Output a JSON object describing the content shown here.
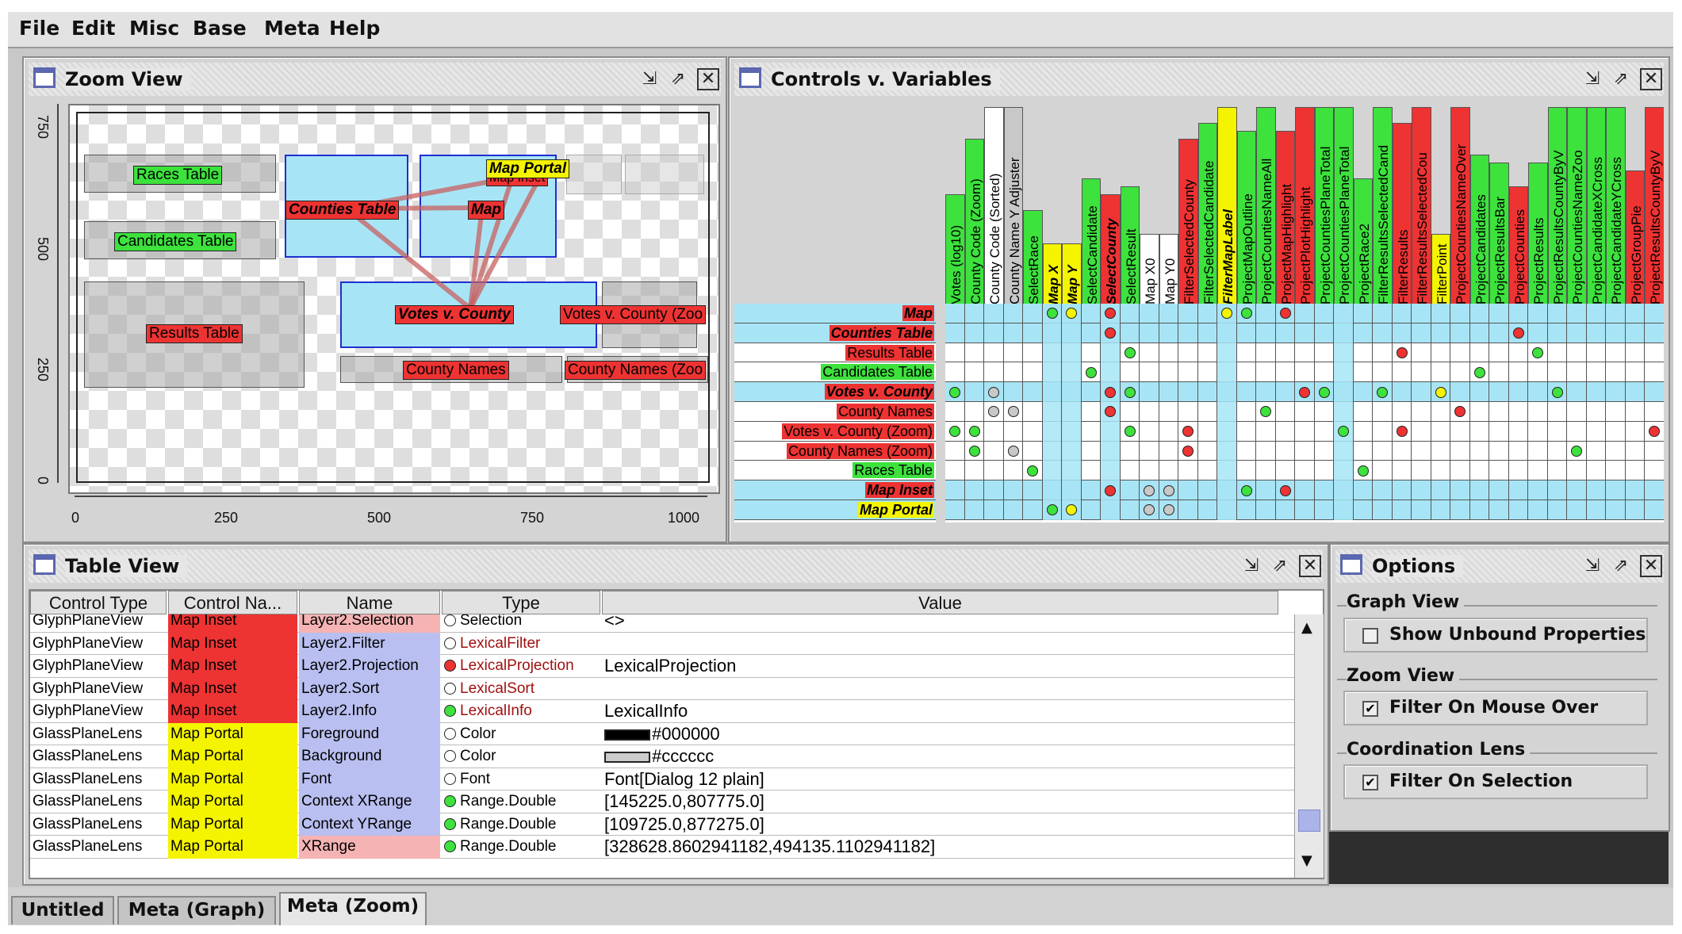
{
  "menu": [
    "File",
    "Edit",
    "Misc",
    "Base",
    "Meta",
    "Help"
  ],
  "zoom_view": {
    "title": "Zoom View",
    "y_ticks": [
      "750",
      "500",
      "250",
      "0"
    ],
    "x_ticks": [
      "0",
      "250",
      "500",
      "750",
      "1000"
    ],
    "labels": {
      "races": "Races Table",
      "candidates": "Candidates Table",
      "results": "Results Table",
      "counties": "Counties Table",
      "map": "Map",
      "map_portal": "Map Portal",
      "map_inset": "Map Inset",
      "votes": "Votes v. County",
      "votes_zoom": "Votes v. County (Zoo",
      "county_names": "County Names",
      "county_names_zoom": "County Names (Zoo"
    }
  },
  "controls_view": {
    "title": "Controls v. Variables",
    "columns": [
      {
        "name": "Votes (log10)",
        "color": "#3de23d",
        "style": "n"
      },
      {
        "name": "County Code (Zoom)",
        "color": "#3de23d",
        "style": "n"
      },
      {
        "name": "County Code (Sorted)",
        "color": "#ffffff",
        "style": "n"
      },
      {
        "name": "County Name Y Adjuster",
        "color": "#c8c8c8",
        "style": "n"
      },
      {
        "name": "SelectRace",
        "color": "#3de23d",
        "style": "n"
      },
      {
        "name": "Map X",
        "color": "#f4f400",
        "style": "bi"
      },
      {
        "name": "Map Y",
        "color": "#f4f400",
        "style": "bi"
      },
      {
        "name": "SelectCandidate",
        "color": "#3de23d",
        "style": "n"
      },
      {
        "name": "SelectCounty",
        "color": "#ee3333",
        "style": "bi"
      },
      {
        "name": "SelectResult",
        "color": "#3de23d",
        "style": "n"
      },
      {
        "name": "Map X0",
        "color": "#ffffff",
        "style": "n"
      },
      {
        "name": "Map Y0",
        "color": "#ffffff",
        "style": "n"
      },
      {
        "name": "FilterSelectedCounty",
        "color": "#ee3333",
        "style": "n"
      },
      {
        "name": "FilterSelectedCandidate",
        "color": "#3de23d",
        "style": "n"
      },
      {
        "name": "FilterMapLabel",
        "color": "#f4f400",
        "style": "bi"
      },
      {
        "name": "ProjectMapOutline",
        "color": "#3de23d",
        "style": "n"
      },
      {
        "name": "ProjectCountiesNameAll",
        "color": "#3de23d",
        "style": "n"
      },
      {
        "name": "ProjectMapHighlight",
        "color": "#ee3333",
        "style": "n"
      },
      {
        "name": "ProjectPlotHighlight",
        "color": "#ee3333",
        "style": "n"
      },
      {
        "name": "ProjectCountiesPlaneTotal",
        "color": "#3de23d",
        "style": "n"
      },
      {
        "name": "ProjectCountiesPlaneTotal",
        "color": "#3de23d",
        "style": "n"
      },
      {
        "name": "ProjectRace2",
        "color": "#3de23d",
        "style": "n"
      },
      {
        "name": "FilterResultsSelectedCand",
        "color": "#3de23d",
        "style": "n"
      },
      {
        "name": "FilterResults",
        "color": "#ee3333",
        "style": "n"
      },
      {
        "name": "FilterResultsSelectedCou",
        "color": "#ee3333",
        "style": "n"
      },
      {
        "name": "FilterPoint",
        "color": "#f4f400",
        "style": "n"
      },
      {
        "name": "ProjectCountiesNameOver",
        "color": "#ee3333",
        "style": "n"
      },
      {
        "name": "ProjectCandidates",
        "color": "#3de23d",
        "style": "n"
      },
      {
        "name": "ProjectResultsBar",
        "color": "#3de23d",
        "style": "n"
      },
      {
        "name": "ProjectCounties",
        "color": "#ee3333",
        "style": "n"
      },
      {
        "name": "ProjectResults",
        "color": "#3de23d",
        "style": "n"
      },
      {
        "name": "ProjectResultsCountyByV",
        "color": "#3de23d",
        "style": "n"
      },
      {
        "name": "ProjectCountiesNameZoo",
        "color": "#3de23d",
        "style": "n"
      },
      {
        "name": "ProjectCandidateXCross",
        "color": "#3de23d",
        "style": "n"
      },
      {
        "name": "ProjectCandidateYCross",
        "color": "#3de23d",
        "style": "n"
      },
      {
        "name": "ProjectGroupPie",
        "color": "#ee3333",
        "style": "n"
      },
      {
        "name": "ProjectResultsCountyByV",
        "color": "#ee3333",
        "style": "n"
      }
    ],
    "rows": [
      {
        "name": "Map",
        "color": "#ee3333",
        "style": "bi",
        "cyan": true
      },
      {
        "name": "Counties Table",
        "color": "#ee3333",
        "style": "bi",
        "cyan": true
      },
      {
        "name": "Results Table",
        "color": "#ee3333",
        "style": "n",
        "cyan": false
      },
      {
        "name": "Candidates Table",
        "color": "#3de23d",
        "style": "n",
        "cyan": false
      },
      {
        "name": "Votes v. County",
        "color": "#ee3333",
        "style": "bi",
        "cyan": true
      },
      {
        "name": "County Names",
        "color": "#ee3333",
        "style": "n",
        "cyan": false
      },
      {
        "name": "Votes v. County (Zoom)",
        "color": "#ee3333",
        "style": "n",
        "cyan": false
      },
      {
        "name": "County Names (Zoom)",
        "color": "#ee3333",
        "style": "n",
        "cyan": false
      },
      {
        "name": "Races Table",
        "color": "#3de23d",
        "style": "n",
        "cyan": false
      },
      {
        "name": "Map Inset",
        "color": "#ee3333",
        "style": "bi",
        "cyan": true
      },
      {
        "name": "Map Portal",
        "color": "#f4f400",
        "style": "bi",
        "cyan": true
      }
    ],
    "dots": [
      [
        0,
        5,
        "#3de23d"
      ],
      [
        0,
        6,
        "#f4f400"
      ],
      [
        0,
        8,
        "#ee3333"
      ],
      [
        0,
        14,
        "#f4f400"
      ],
      [
        0,
        15,
        "#3de23d"
      ],
      [
        0,
        17,
        "#ee3333"
      ],
      [
        1,
        8,
        "#ee3333"
      ],
      [
        1,
        29,
        "#ee3333"
      ],
      [
        2,
        9,
        "#3de23d"
      ],
      [
        2,
        23,
        "#ee3333"
      ],
      [
        2,
        30,
        "#3de23d"
      ],
      [
        3,
        7,
        "#3de23d"
      ],
      [
        3,
        27,
        "#3de23d"
      ],
      [
        4,
        0,
        "#3de23d"
      ],
      [
        4,
        2,
        "#c8c8c8"
      ],
      [
        4,
        8,
        "#ee3333"
      ],
      [
        4,
        9,
        "#3de23d"
      ],
      [
        4,
        18,
        "#ee3333"
      ],
      [
        4,
        19,
        "#3de23d"
      ],
      [
        4,
        22,
        "#3de23d"
      ],
      [
        4,
        25,
        "#f4f400"
      ],
      [
        4,
        31,
        "#3de23d"
      ],
      [
        5,
        2,
        "#c8c8c8"
      ],
      [
        5,
        3,
        "#c8c8c8"
      ],
      [
        5,
        8,
        "#ee3333"
      ],
      [
        5,
        16,
        "#3de23d"
      ],
      [
        5,
        26,
        "#ee3333"
      ],
      [
        6,
        0,
        "#3de23d"
      ],
      [
        6,
        1,
        "#3de23d"
      ],
      [
        6,
        9,
        "#3de23d"
      ],
      [
        6,
        12,
        "#ee3333"
      ],
      [
        6,
        20,
        "#3de23d"
      ],
      [
        6,
        23,
        "#ee3333"
      ],
      [
        6,
        36,
        "#ee3333"
      ],
      [
        7,
        1,
        "#3de23d"
      ],
      [
        7,
        3,
        "#c8c8c8"
      ],
      [
        7,
        12,
        "#ee3333"
      ],
      [
        7,
        32,
        "#3de23d"
      ],
      [
        8,
        4,
        "#3de23d"
      ],
      [
        8,
        21,
        "#3de23d"
      ],
      [
        9,
        8,
        "#ee3333"
      ],
      [
        9,
        10,
        "#c8c8c8"
      ],
      [
        9,
        11,
        "#c8c8c8"
      ],
      [
        9,
        15,
        "#3de23d"
      ],
      [
        9,
        17,
        "#ee3333"
      ],
      [
        10,
        5,
        "#3de23d"
      ],
      [
        10,
        6,
        "#f4f400"
      ],
      [
        10,
        10,
        "#c8c8c8"
      ],
      [
        10,
        11,
        "#c8c8c8"
      ]
    ]
  },
  "table_view": {
    "title": "Table View",
    "headers": [
      "Control Type",
      "Control Na...",
      "Name",
      "Type",
      "Value"
    ],
    "rows": [
      {
        "ctype": "GlyphPlaneView",
        "cname": "Map Inset",
        "ccolor": "#ee3333",
        "name": "Layer2.Selection",
        "ncolor": "#f5b3b3",
        "tcolor": "#ffffff",
        "type": "Selection",
        "tred": false,
        "value": "<>",
        "swatch": ""
      },
      {
        "ctype": "GlyphPlaneView",
        "cname": "Map Inset",
        "ccolor": "#ee3333",
        "name": "Layer2.Filter",
        "ncolor": "#b9bff0",
        "tcolor": "#ffffff",
        "type": "LexicalFilter",
        "tred": true,
        "value": "",
        "swatch": ""
      },
      {
        "ctype": "GlyphPlaneView",
        "cname": "Map Inset",
        "ccolor": "#ee3333",
        "name": "Layer2.Projection",
        "ncolor": "#b9bff0",
        "tcolor": "#ee3333",
        "type": "LexicalProjection",
        "tred": true,
        "value": "LexicalProjection",
        "swatch": ""
      },
      {
        "ctype": "GlyphPlaneView",
        "cname": "Map Inset",
        "ccolor": "#ee3333",
        "name": "Layer2.Sort",
        "ncolor": "#b9bff0",
        "tcolor": "#ffffff",
        "type": "LexicalSort",
        "tred": true,
        "value": "",
        "swatch": ""
      },
      {
        "ctype": "GlyphPlaneView",
        "cname": "Map Inset",
        "ccolor": "#ee3333",
        "name": "Layer2.Info",
        "ncolor": "#b9bff0",
        "tcolor": "#3de23d",
        "type": "LexicalInfo",
        "tred": true,
        "value": "LexicalInfo",
        "swatch": ""
      },
      {
        "ctype": "GlassPlaneLens",
        "cname": "Map Portal",
        "ccolor": "#f4f400",
        "name": "Foreground",
        "ncolor": "#b9bff0",
        "tcolor": "#ffffff",
        "type": "Color",
        "tred": false,
        "value": "#000000",
        "swatch": "#000000"
      },
      {
        "ctype": "GlassPlaneLens",
        "cname": "Map Portal",
        "ccolor": "#f4f400",
        "name": "Background",
        "ncolor": "#b9bff0",
        "tcolor": "#ffffff",
        "type": "Color",
        "tred": false,
        "value": "#cccccc",
        "swatch": "#cccccc"
      },
      {
        "ctype": "GlassPlaneLens",
        "cname": "Map Portal",
        "ccolor": "#f4f400",
        "name": "Font",
        "ncolor": "#b9bff0",
        "tcolor": "#ffffff",
        "type": "Font",
        "tred": false,
        "value": "Font[Dialog 12 plain]",
        "swatch": ""
      },
      {
        "ctype": "GlassPlaneLens",
        "cname": "Map Portal",
        "ccolor": "#f4f400",
        "name": "Context XRange",
        "ncolor": "#b9bff0",
        "tcolor": "#3de23d",
        "type": "Range.Double",
        "tred": false,
        "value": "[145225.0,807775.0]",
        "swatch": ""
      },
      {
        "ctype": "GlassPlaneLens",
        "cname": "Map Portal",
        "ccolor": "#f4f400",
        "name": "Context YRange",
        "ncolor": "#b9bff0",
        "tcolor": "#3de23d",
        "type": "Range.Double",
        "tred": false,
        "value": "[109725.0,877275.0]",
        "swatch": ""
      },
      {
        "ctype": "GlassPlaneLens",
        "cname": "Map Portal",
        "ccolor": "#f4f400",
        "name": "XRange",
        "ncolor": "#f5b3b3",
        "tcolor": "#3de23d",
        "type": "Range.Double",
        "tred": false,
        "value": "[328628.8602941182,494135.1102941182]",
        "swatch": ""
      }
    ]
  },
  "options": {
    "title": "Options",
    "groups": [
      {
        "title": "Graph View",
        "label": "Show Unbound Properties",
        "checked": ""
      },
      {
        "title": "Zoom View",
        "label": "Filter On Mouse Over",
        "checked": "✔"
      },
      {
        "title": "Coordination Lens",
        "label": "Filter On Selection",
        "checked": "✔"
      }
    ]
  },
  "tabs": [
    "Untitled",
    "Meta (Graph)",
    "Meta (Zoom)"
  ]
}
